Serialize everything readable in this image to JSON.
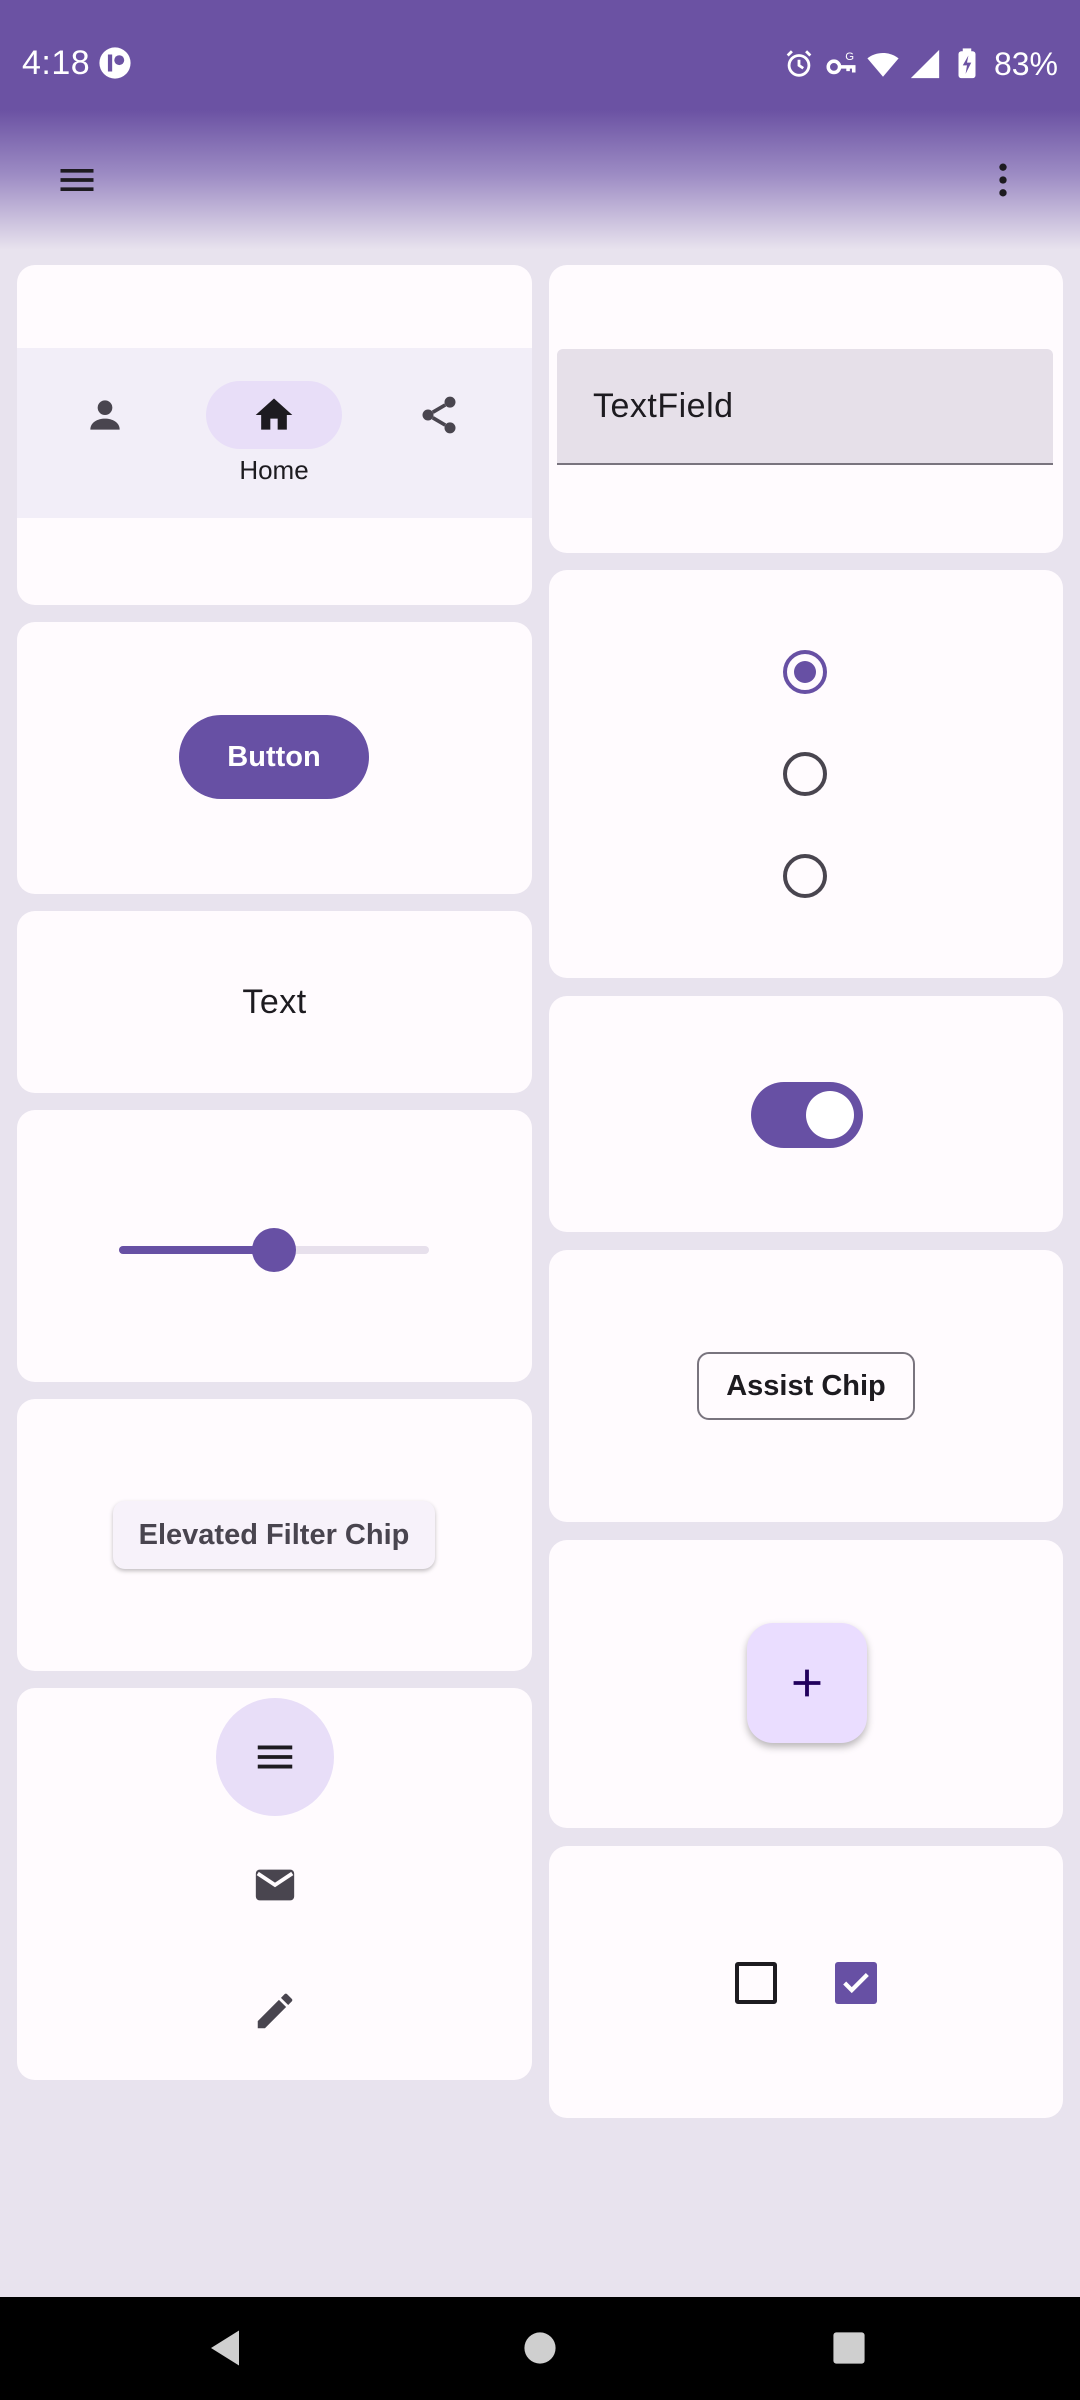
{
  "status_bar": {
    "time": "4:18",
    "battery_percent": "83%",
    "icons": [
      "app-notification-icon",
      "alarm-icon",
      "vpn-key-icon",
      "wifi-icon",
      "signal-icon",
      "battery-charging-icon"
    ]
  },
  "app_bar": {
    "menu_icon": "menu-icon",
    "overflow_icon": "more-vert-icon"
  },
  "navigation_bar": {
    "items": [
      {
        "icon": "person-icon",
        "label": "",
        "selected": false
      },
      {
        "icon": "home-icon",
        "label": "Home",
        "selected": true
      },
      {
        "icon": "share-icon",
        "label": "",
        "selected": false
      }
    ]
  },
  "text_field": {
    "label": "TextField"
  },
  "button": {
    "label": "Button"
  },
  "radio_group": {
    "options": [
      {
        "selected": true
      },
      {
        "selected": false
      },
      {
        "selected": false
      }
    ]
  },
  "text_sample": {
    "text": "Text"
  },
  "switch": {
    "checked": true
  },
  "slider": {
    "value": 0.5
  },
  "assist_chip": {
    "label": "Assist Chip"
  },
  "filter_chip": {
    "label": "Elevated Filter Chip"
  },
  "fab": {
    "icon": "add-icon"
  },
  "navigation_rail": {
    "items": [
      "menu-icon",
      "mail-icon",
      "edit-icon"
    ],
    "selected_index": 0
  },
  "checkboxes": [
    {
      "checked": false
    },
    {
      "checked": true
    }
  ],
  "colors": {
    "primary": "#6750a4",
    "primary_container": "#eaddff",
    "secondary_container": "#e8def8",
    "surface": "#fffbfe",
    "background": "#e8e3ee",
    "top_bar": "#6b52a3"
  },
  "system_nav": {
    "buttons": [
      "back-icon",
      "home-circle-icon",
      "recents-icon"
    ]
  }
}
